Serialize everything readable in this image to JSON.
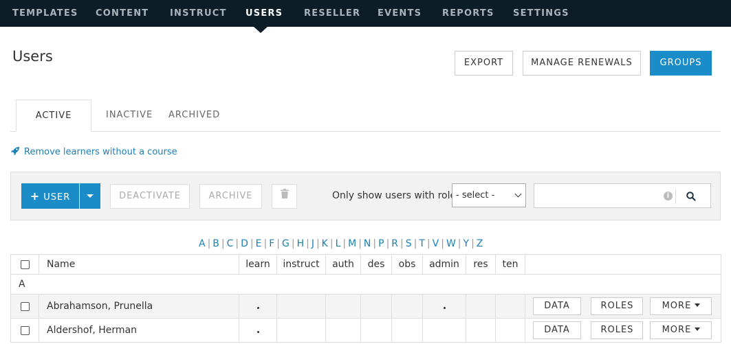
{
  "nav": {
    "items": [
      {
        "label": "TEMPLATES",
        "active": false
      },
      {
        "label": "CONTENT",
        "active": false
      },
      {
        "label": "INSTRUCT",
        "active": false
      },
      {
        "label": "USERS",
        "active": true
      },
      {
        "label": "RESELLER",
        "active": false
      },
      {
        "label": "EVENTS",
        "active": false
      },
      {
        "label": "REPORTS",
        "active": false
      },
      {
        "label": "SETTINGS",
        "active": false
      }
    ]
  },
  "page": {
    "title": "Users"
  },
  "header_buttons": {
    "export": "EXPORT",
    "manage_renewals": "MANAGE RENEWALS",
    "groups": "GROUPS"
  },
  "tabs": [
    {
      "label": "ACTIVE",
      "active": true
    },
    {
      "label": "INACTIVE",
      "active": false
    },
    {
      "label": "ARCHIVED",
      "active": false
    }
  ],
  "remove_link": {
    "label": "Remove learners without a course",
    "icon": "rocket-icon"
  },
  "toolbar": {
    "user_button": "USER",
    "deactivate": "DEACTIVATE",
    "archive": "ARCHIVE",
    "role_label": "Only show users with role:",
    "role_select_value": "- select -",
    "search_value": ""
  },
  "alphabet": [
    "A",
    "B",
    "C",
    "D",
    "E",
    "F",
    "G",
    "H",
    "J",
    "K",
    "L",
    "M",
    "N",
    "P",
    "R",
    "S",
    "T",
    "V",
    "W",
    "Y",
    "Z"
  ],
  "table": {
    "columns": [
      "Name",
      "learn",
      "instruct",
      "auth",
      "des",
      "obs",
      "admin",
      "res",
      "ten"
    ],
    "group_label": "A",
    "rows": [
      {
        "name": "Abrahamson, Prunella",
        "roles": [
          true,
          false,
          false,
          false,
          false,
          true,
          false,
          false
        ],
        "actions": {
          "data": "DATA",
          "roles": "ROLES",
          "more": "MORE"
        }
      },
      {
        "name": "Aldershof, Herman",
        "roles": [
          true,
          false,
          false,
          false,
          false,
          false,
          false,
          false
        ],
        "actions": {
          "data": "DATA",
          "roles": "ROLES",
          "more": "MORE"
        }
      }
    ]
  },
  "colors": {
    "nav_bg": "#0c1d27",
    "primary": "#1a8cc7",
    "link": "#1a7fb5"
  }
}
